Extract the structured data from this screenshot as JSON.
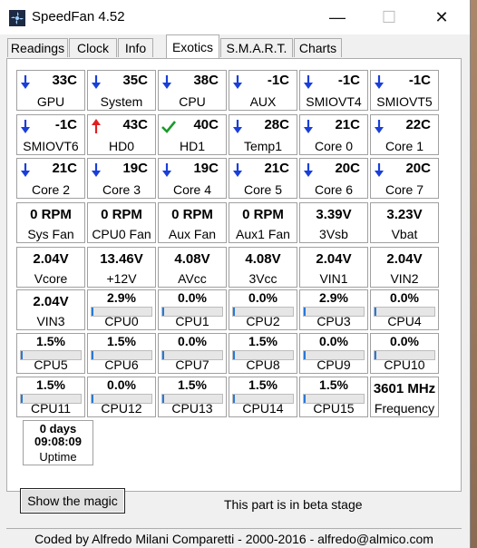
{
  "window": {
    "title": "SpeedFan 4.52",
    "min_glyph": "—",
    "max_glyph": "☐",
    "close_glyph": "✕"
  },
  "tabs": [
    {
      "label": "Readings",
      "active": false
    },
    {
      "label": "Clock",
      "active": false
    },
    {
      "label": "Info",
      "active": false
    },
    {
      "label": "Exotics",
      "active": true
    },
    {
      "label": "S.M.A.R.T.",
      "active": false
    },
    {
      "label": "Charts",
      "active": false
    }
  ],
  "temps": [
    {
      "value": "33C",
      "label": "GPU",
      "trend": "down"
    },
    {
      "value": "35C",
      "label": "System",
      "trend": "down"
    },
    {
      "value": "38C",
      "label": "CPU",
      "trend": "down"
    },
    {
      "value": "-1C",
      "label": "AUX",
      "trend": "down"
    },
    {
      "value": "-1C",
      "label": "SMIOVT4",
      "trend": "down"
    },
    {
      "value": "-1C",
      "label": "SMIOVT5",
      "trend": "down"
    },
    {
      "value": "-1C",
      "label": "SMIOVT6",
      "trend": "down"
    },
    {
      "value": "43C",
      "label": "HD0",
      "trend": "up"
    },
    {
      "value": "40C",
      "label": "HD1",
      "trend": "ok"
    },
    {
      "value": "28C",
      "label": "Temp1",
      "trend": "down"
    },
    {
      "value": "21C",
      "label": "Core 0",
      "trend": "down"
    },
    {
      "value": "22C",
      "label": "Core 1",
      "trend": "down"
    },
    {
      "value": "21C",
      "label": "Core 2",
      "trend": "down"
    },
    {
      "value": "19C",
      "label": "Core 3",
      "trend": "down"
    },
    {
      "value": "19C",
      "label": "Core 4",
      "trend": "down"
    },
    {
      "value": "21C",
      "label": "Core 5",
      "trend": "down"
    },
    {
      "value": "20C",
      "label": "Core 6",
      "trend": "down"
    },
    {
      "value": "20C",
      "label": "Core 7",
      "trend": "down"
    }
  ],
  "fans": [
    {
      "value": "0 RPM",
      "label": "Sys Fan"
    },
    {
      "value": "0 RPM",
      "label": "CPU0 Fan"
    },
    {
      "value": "0 RPM",
      "label": "Aux Fan"
    },
    {
      "value": "0 RPM",
      "label": "Aux1 Fan"
    },
    {
      "value": "3.39V",
      "label": "3Vsb"
    },
    {
      "value": "3.23V",
      "label": "Vbat"
    }
  ],
  "volts": [
    {
      "value": "2.04V",
      "label": "Vcore"
    },
    {
      "value": "13.46V",
      "label": "+12V"
    },
    {
      "value": "4.08V",
      "label": "AVcc"
    },
    {
      "value": "4.08V",
      "label": "3Vcc"
    },
    {
      "value": "2.04V",
      "label": "VIN1"
    },
    {
      "value": "2.04V",
      "label": "VIN2"
    },
    {
      "value": "2.04V",
      "label": "VIN3"
    }
  ],
  "cpus": [
    {
      "value": "2.9%",
      "label": "CPU0",
      "pct": 2.9
    },
    {
      "value": "0.0%",
      "label": "CPU1",
      "pct": 0.0
    },
    {
      "value": "0.0%",
      "label": "CPU2",
      "pct": 0.0
    },
    {
      "value": "2.9%",
      "label": "CPU3",
      "pct": 2.9
    },
    {
      "value": "0.0%",
      "label": "CPU4",
      "pct": 0.0
    },
    {
      "value": "1.5%",
      "label": "CPU5",
      "pct": 1.5
    },
    {
      "value": "1.5%",
      "label": "CPU6",
      "pct": 1.5
    },
    {
      "value": "0.0%",
      "label": "CPU7",
      "pct": 0.0
    },
    {
      "value": "1.5%",
      "label": "CPU8",
      "pct": 1.5
    },
    {
      "value": "0.0%",
      "label": "CPU9",
      "pct": 0.0
    },
    {
      "value": "0.0%",
      "label": "CPU10",
      "pct": 0.0
    },
    {
      "value": "1.5%",
      "label": "CPU11",
      "pct": 1.5
    },
    {
      "value": "0.0%",
      "label": "CPU12",
      "pct": 0.0
    },
    {
      "value": "1.5%",
      "label": "CPU13",
      "pct": 1.5
    },
    {
      "value": "1.5%",
      "label": "CPU14",
      "pct": 1.5
    },
    {
      "value": "1.5%",
      "label": "CPU15",
      "pct": 1.5
    }
  ],
  "frequency": {
    "value": "3601 MHz",
    "label": "Frequency"
  },
  "uptime": {
    "days": "0 days",
    "time": "09:08:09",
    "label": "Uptime"
  },
  "magic_button": "Show the magic",
  "beta_note": "This part is in beta stage",
  "footer": "Coded by Alfredo Milani Comparetti - 2000-2016 - alfredo@almico.com",
  "colors": {
    "arrow_down": "#1a3fd8",
    "arrow_up": "#e02020",
    "check_ok": "#1a9a2a",
    "bar_fill": "#2a78d6"
  }
}
